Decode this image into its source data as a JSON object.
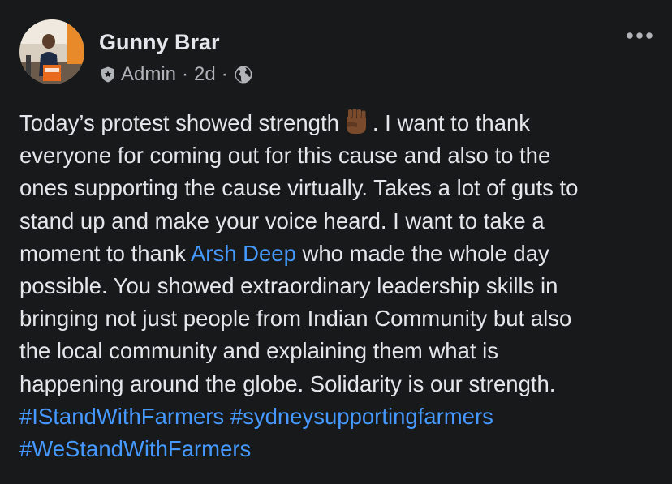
{
  "post": {
    "author": "Gunny Brar",
    "role": "Admin",
    "separator": "·",
    "time_ago": "2d",
    "more_glyph": "•••",
    "colors": {
      "background": "#18191a",
      "primary_text": "#e4e6eb",
      "secondary_text": "#b0b3b8",
      "link": "#4599ff"
    },
    "icons": {
      "admin_badge": "shield-badge-icon",
      "privacy": "globe-icon",
      "more": "more-options-icon",
      "emoji": "raised-fist-emoji"
    },
    "body": {
      "l1_a": "Today’s protest showed strength",
      "l1_b": ". I want to thank",
      "l2": "everyone for coming out for this cause and also to the",
      "l3": "ones supporting the cause virtually. Takes a lot of guts to",
      "l4": "stand up and make your voice heard. I want to take a",
      "l5_a": "moment to thank ",
      "mention": "Arsh Deep",
      "l5_b": " who made the whole day",
      "l6": "possible. You showed extraordinary leadership skills in",
      "l7": "bringing not just people from Indian Community but also",
      "l8": "the local community and explaining them what is",
      "l9": "happening around the globe. Solidarity is our strength.",
      "hashtag1": "#IStandWithFarmers",
      "hashtag2": "#sydneysupportingfarmers",
      "hashtag3": "#WeStandWithFarmers"
    }
  }
}
